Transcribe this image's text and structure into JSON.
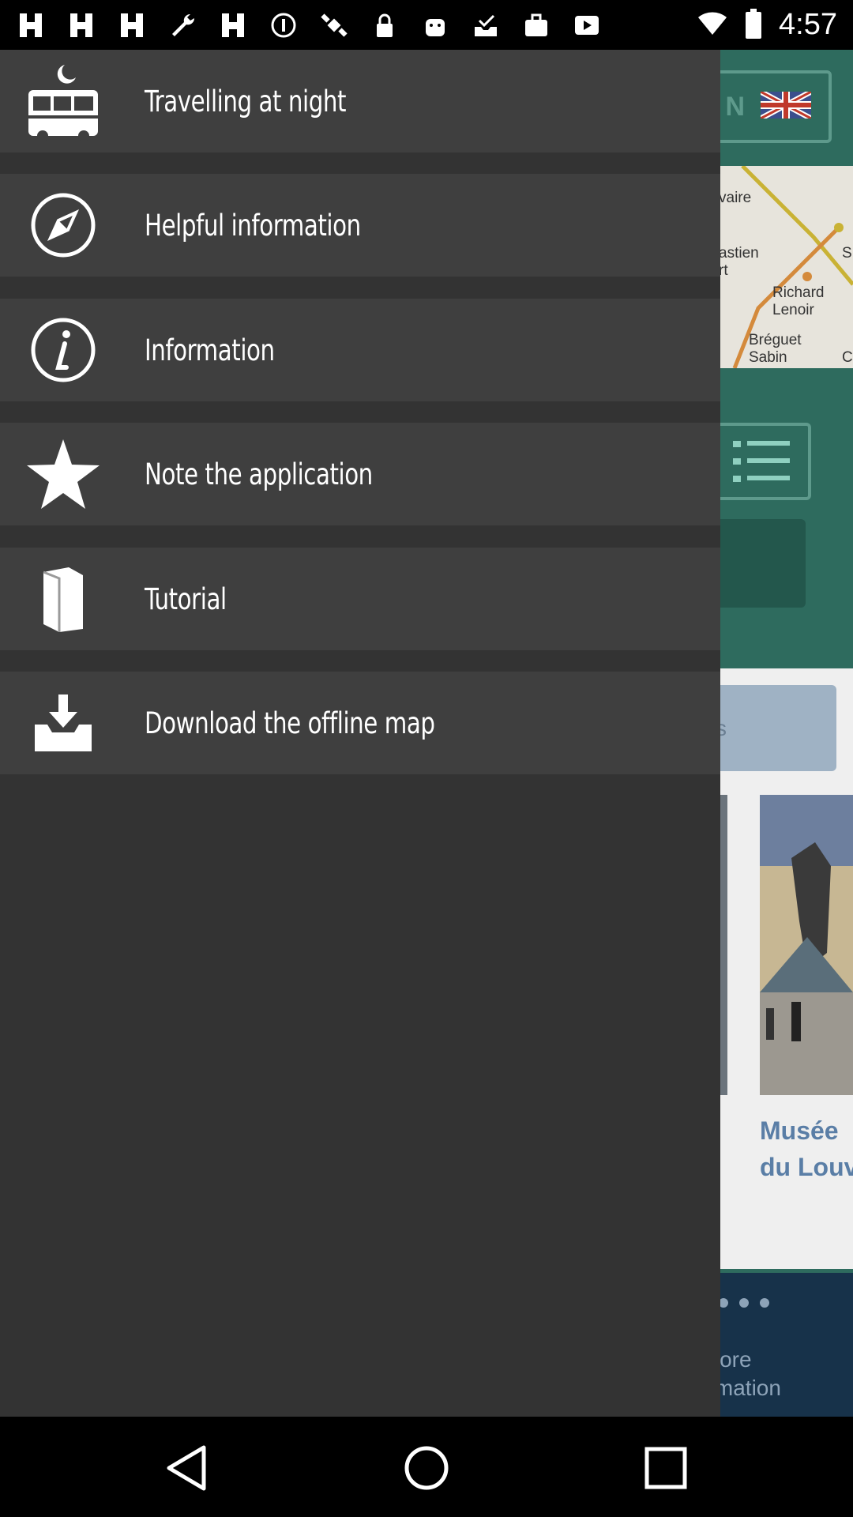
{
  "status_bar": {
    "time": "4:57",
    "notification_icons": [
      "grid-icon",
      "grid-icon",
      "grid-icon",
      "wrench-icon",
      "grid-icon",
      "info-circle-icon",
      "satellite-icon",
      "lock-icon",
      "android-icon",
      "inbox-check-icon",
      "briefcase-icon",
      "play-icon"
    ],
    "right_icons": [
      "wifi-icon",
      "battery-icon"
    ]
  },
  "background_app": {
    "language_button": {
      "text": "N",
      "flag": "uk-flag-icon"
    },
    "map_labels": [
      "vaire",
      "astien\nrt",
      "Richard\nLenoir",
      "Bréguet\nSabin",
      "S",
      "C"
    ],
    "grey_button_text": "s",
    "museum_title": "Musée\ndu Louv",
    "more_information": " More\normation"
  },
  "drawer": {
    "items": [
      {
        "label": "Travelling at night",
        "icon": "night-bus-icon"
      },
      {
        "label": "Helpful information",
        "icon": "compass-icon"
      },
      {
        "label": "Information",
        "icon": "info-icon"
      },
      {
        "label": "Note the application",
        "icon": "star-icon"
      },
      {
        "label": "Tutorial",
        "icon": "book-icon"
      },
      {
        "label": "Download the offline map",
        "icon": "download-icon"
      }
    ]
  },
  "colors": {
    "drawer_bg": "#333333",
    "item_bg": "#3f3f3f",
    "app_accent": "#2e6b5e"
  },
  "nav_bar": {
    "buttons": [
      "back-icon",
      "home-icon",
      "recents-icon"
    ]
  }
}
